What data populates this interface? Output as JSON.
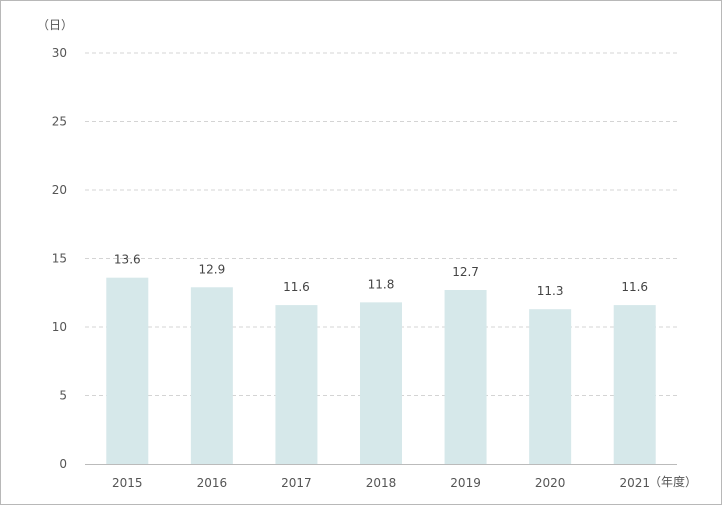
{
  "chart_data": {
    "type": "bar",
    "categories": [
      "2015",
      "2016",
      "2017",
      "2018",
      "2019",
      "2020",
      "2021"
    ],
    "values": [
      13.6,
      12.9,
      11.6,
      11.8,
      12.7,
      11.3,
      11.6
    ],
    "data_labels": [
      "13.6",
      "12.9",
      "11.6",
      "11.8",
      "12.7",
      "11.3",
      "11.6"
    ],
    "y_unit": "（日）",
    "x_unit": "（年度）",
    "ylim": [
      0,
      30
    ],
    "yticks": [
      0,
      5,
      10,
      15,
      20,
      25,
      30
    ],
    "grid": true,
    "bar_color": "#d6e8ea",
    "grid_color": "#d4d4d4",
    "axis_color": "#bbbbbb"
  }
}
